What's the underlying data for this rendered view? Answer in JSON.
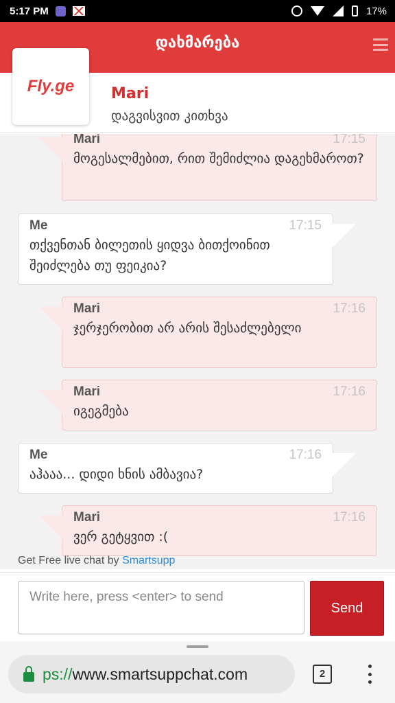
{
  "status_bar": {
    "time": "5:17 PM",
    "battery": "17%"
  },
  "header": {
    "title": "დახმარება"
  },
  "agent": {
    "logo": "Fly.ge",
    "name": "Mari",
    "subtitle": "დაგვისვით კითხვა"
  },
  "messages": [
    {
      "author": "Mari",
      "time": "17:15",
      "text": "მოგესალმებით, რით შემიძლია დაგეხმაროთ?"
    },
    {
      "author": "Me",
      "time": "17:15",
      "text": "თქვენთან ბილეთის ყიდვა ბითქოინით შეიძლება თუ ფეიკია?"
    },
    {
      "author": "Mari",
      "time": "17:16",
      "text": "ჯერჯერობით არ არის შესაძლებელი"
    },
    {
      "author": "Mari",
      "time": "17:16",
      "text": "იგეგმება"
    },
    {
      "author": "Me",
      "time": "17:16",
      "text": "აჰააა... დიდი ხნის ამბავია?"
    },
    {
      "author": "Mari",
      "time": "17:16",
      "text": "ვერ გეტყვით :("
    }
  ],
  "powered_by": {
    "prefix": "Get Free live chat by ",
    "brand": "Smartsupp"
  },
  "compose": {
    "placeholder": "Write here, press <enter> to send",
    "send_label": "Send"
  },
  "browser": {
    "url_scheme": "ps://",
    "url_host": "www.smartsuppchat.com",
    "tab_count": "2"
  },
  "colors": {
    "accent": "#e03c3b",
    "send": "#c62026",
    "agent_bubble": "#fbe9ea",
    "link": "#2e8bd6",
    "secure": "#1a8e3e"
  }
}
